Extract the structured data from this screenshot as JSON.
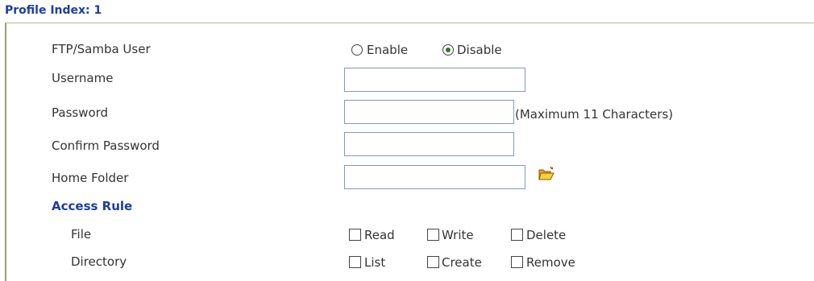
{
  "title": "Profile Index: 1",
  "fields": {
    "ftp_user_label": "FTP/Samba User",
    "username_label": "Username",
    "password_label": "Password",
    "confirm_label": "Confirm Password",
    "home_label": "Home Folder",
    "username_value": "",
    "password_value": "",
    "confirm_value": "",
    "home_value": "",
    "password_hint": "(Maximum 11 Characters)"
  },
  "ftp_user": {
    "enable_label": "Enable",
    "disable_label": "Disable",
    "selected": "Disable"
  },
  "access_rule": {
    "heading": "Access Rule",
    "file_label": "File",
    "directory_label": "Directory",
    "file_options": [
      {
        "label": "Read",
        "checked": false
      },
      {
        "label": "Write",
        "checked": false
      },
      {
        "label": "Delete",
        "checked": false
      }
    ],
    "directory_options": [
      {
        "label": "List",
        "checked": false
      },
      {
        "label": "Create",
        "checked": false
      },
      {
        "label": "Remove",
        "checked": false
      }
    ]
  },
  "icons": {
    "home_folder_browse": "folder-open-icon"
  }
}
